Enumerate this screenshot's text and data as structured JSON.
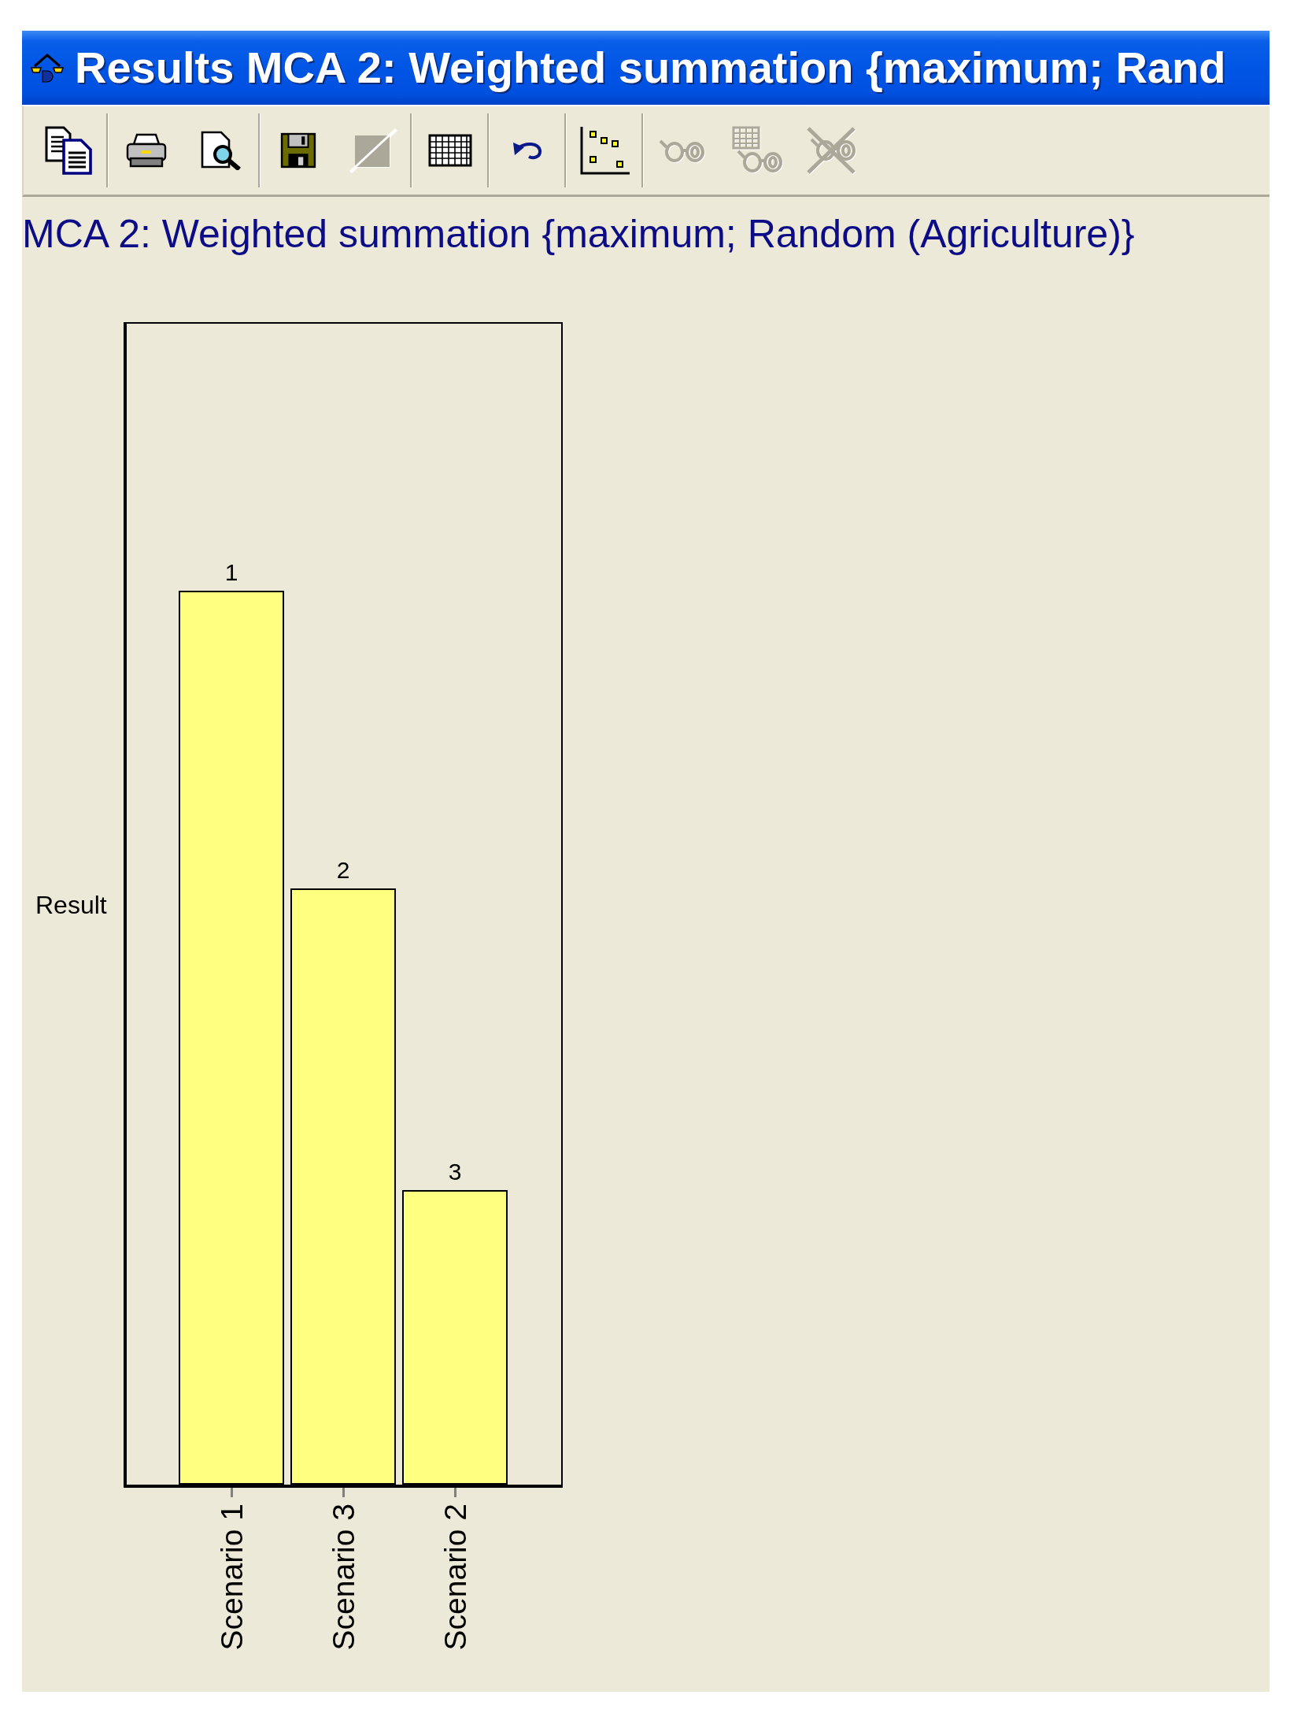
{
  "window": {
    "title": "Results MCA 2: Weighted summation {maximum; Rand"
  },
  "toolbar": {
    "groups": [
      {
        "buttons": [
          {
            "disabled": false
          }
        ]
      },
      {
        "buttons": [
          {
            "disabled": false
          },
          {
            "disabled": false
          }
        ]
      },
      {
        "buttons": [
          {
            "disabled": false
          },
          {
            "disabled": true
          }
        ]
      },
      {
        "buttons": [
          {
            "disabled": false
          }
        ]
      },
      {
        "buttons": [
          {
            "disabled": false
          }
        ]
      },
      {
        "buttons": [
          {
            "disabled": false
          }
        ]
      },
      {
        "buttons": [
          {
            "disabled": true
          },
          {
            "disabled": true
          },
          {
            "disabled": true
          }
        ]
      }
    ]
  },
  "heading": "MCA 2: Weighted summation {maximum; Random (Agriculture)}",
  "chart": {
    "y_axis_label": "Result",
    "bars": [
      {
        "category": "Scenario 1",
        "rank": "1"
      },
      {
        "category": "Scenario 3",
        "rank": "2"
      },
      {
        "category": "Scenario 2",
        "rank": "3"
      }
    ]
  }
}
